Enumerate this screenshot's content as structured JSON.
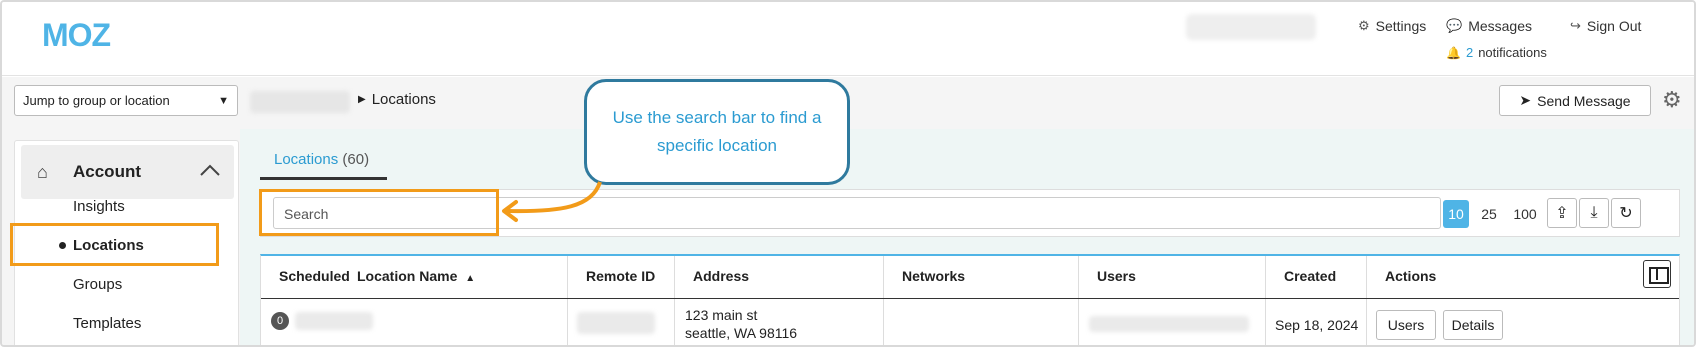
{
  "header": {
    "logo_text": "MOZ",
    "settings_label": "Settings",
    "messages_label": "Messages",
    "signout_label": "Sign Out",
    "notifications_count": "2",
    "notifications_label": "notifications"
  },
  "subbar": {
    "jump_placeholder": "Jump to group or location",
    "breadcrumb_current": "Locations",
    "send_message_label": "Send Message"
  },
  "sidebar": {
    "account_label": "Account",
    "items": [
      {
        "label": "Insights"
      },
      {
        "label": "Locations"
      },
      {
        "label": "Groups"
      },
      {
        "label": "Templates"
      }
    ]
  },
  "tabs": {
    "locations_label": "Locations",
    "locations_count": "(60)"
  },
  "toolbar": {
    "search_placeholder": "Search",
    "page_sizes": [
      "10",
      "25",
      "100"
    ],
    "selected_page_size": "10"
  },
  "table": {
    "columns": [
      "Scheduled",
      "Location Name",
      "Remote ID",
      "Address",
      "Networks",
      "Users",
      "Created",
      "Actions"
    ],
    "rows": [
      {
        "scheduled": "0",
        "address_line1": "123 main st",
        "address_line2": "seattle, WA 98116",
        "created": "Sep 18, 2024",
        "users_button": "Users",
        "details_button": "Details"
      }
    ]
  },
  "callout": {
    "text": "Use the search bar to find a specific location"
  },
  "colors": {
    "accent": "#2b9bd1",
    "highlight": "#f29b19",
    "callout_border": "#2f7a9e",
    "logo": "#4fb4e6"
  }
}
